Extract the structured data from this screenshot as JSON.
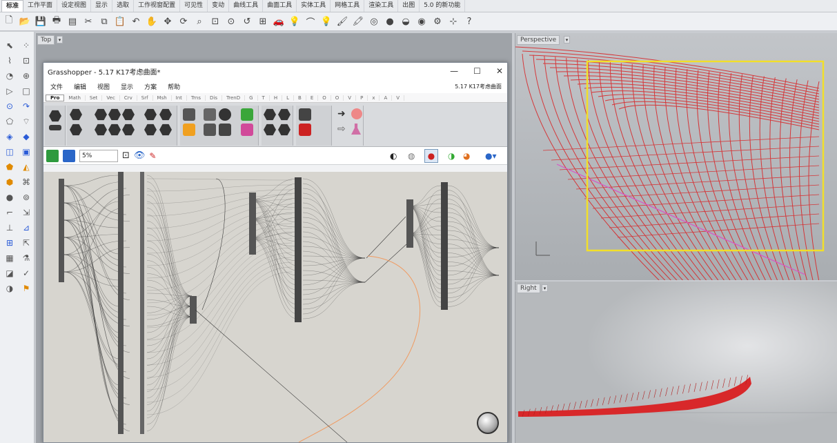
{
  "tabs": [
    "标准",
    "工作平面",
    "设定视图",
    "显示",
    "选取",
    "工作视窗配置",
    "可见性",
    "变动",
    "曲线工具",
    "曲面工具",
    "实体工具",
    "网格工具",
    "渲染工具",
    "出图",
    "5.0 的新功能"
  ],
  "active_tab": 0,
  "toolbar_icons": [
    "new-file-icon",
    "open-folder-icon",
    "save-icon",
    "print-icon",
    "properties-icon",
    "cut-icon",
    "copy-icon",
    "paste-icon",
    "undo-icon",
    "pan-hand-icon",
    "move-view-icon",
    "rotate-view-icon",
    "zoom-window-icon",
    "zoom-extents-icon",
    "zoom-selected-icon",
    "undo-view-icon",
    "four-viewports-icon",
    "car-icon",
    "light-icon",
    "lasso-icon",
    "bulb-icon",
    "brush-icon",
    "paint-icon",
    "color-wheel-icon",
    "sphere-icon",
    "shaded-icon",
    "render-icon",
    "gear-icon",
    "grid-snap-icon",
    "help-icon"
  ],
  "viewports": {
    "top_label": "Top",
    "perspective_label": "Perspective",
    "right_label": "Right"
  },
  "grasshopper": {
    "title": "Grasshopper - 5.17  K17考虑曲面*",
    "minimize": "—",
    "maximize": "☐",
    "close": "✕",
    "menu": [
      "文件",
      "编辑",
      "视图",
      "显示",
      "方案",
      "帮助"
    ],
    "menu_right": "5.17  K17考虑曲面",
    "categories": [
      "Pro",
      "Math",
      "Set",
      "Vec",
      "Crv",
      "Srf",
      "Msh",
      "Int",
      "Trns",
      "Dis",
      "TrenD",
      "G",
      "T",
      "H",
      "L",
      "B",
      "E",
      "O",
      "O",
      "V",
      "P",
      "x",
      "A",
      "V"
    ],
    "ribbon_groups": [
      "",
      "",
      "",
      "",
      "",
      ""
    ],
    "zoom": "5%"
  },
  "colors": {
    "accent_red": "#d8282a",
    "selection_yellow": "#f2df29",
    "canvas": "#d7d5cf",
    "wire": "#3a3a3a",
    "wire_orange": "#f09a60"
  }
}
